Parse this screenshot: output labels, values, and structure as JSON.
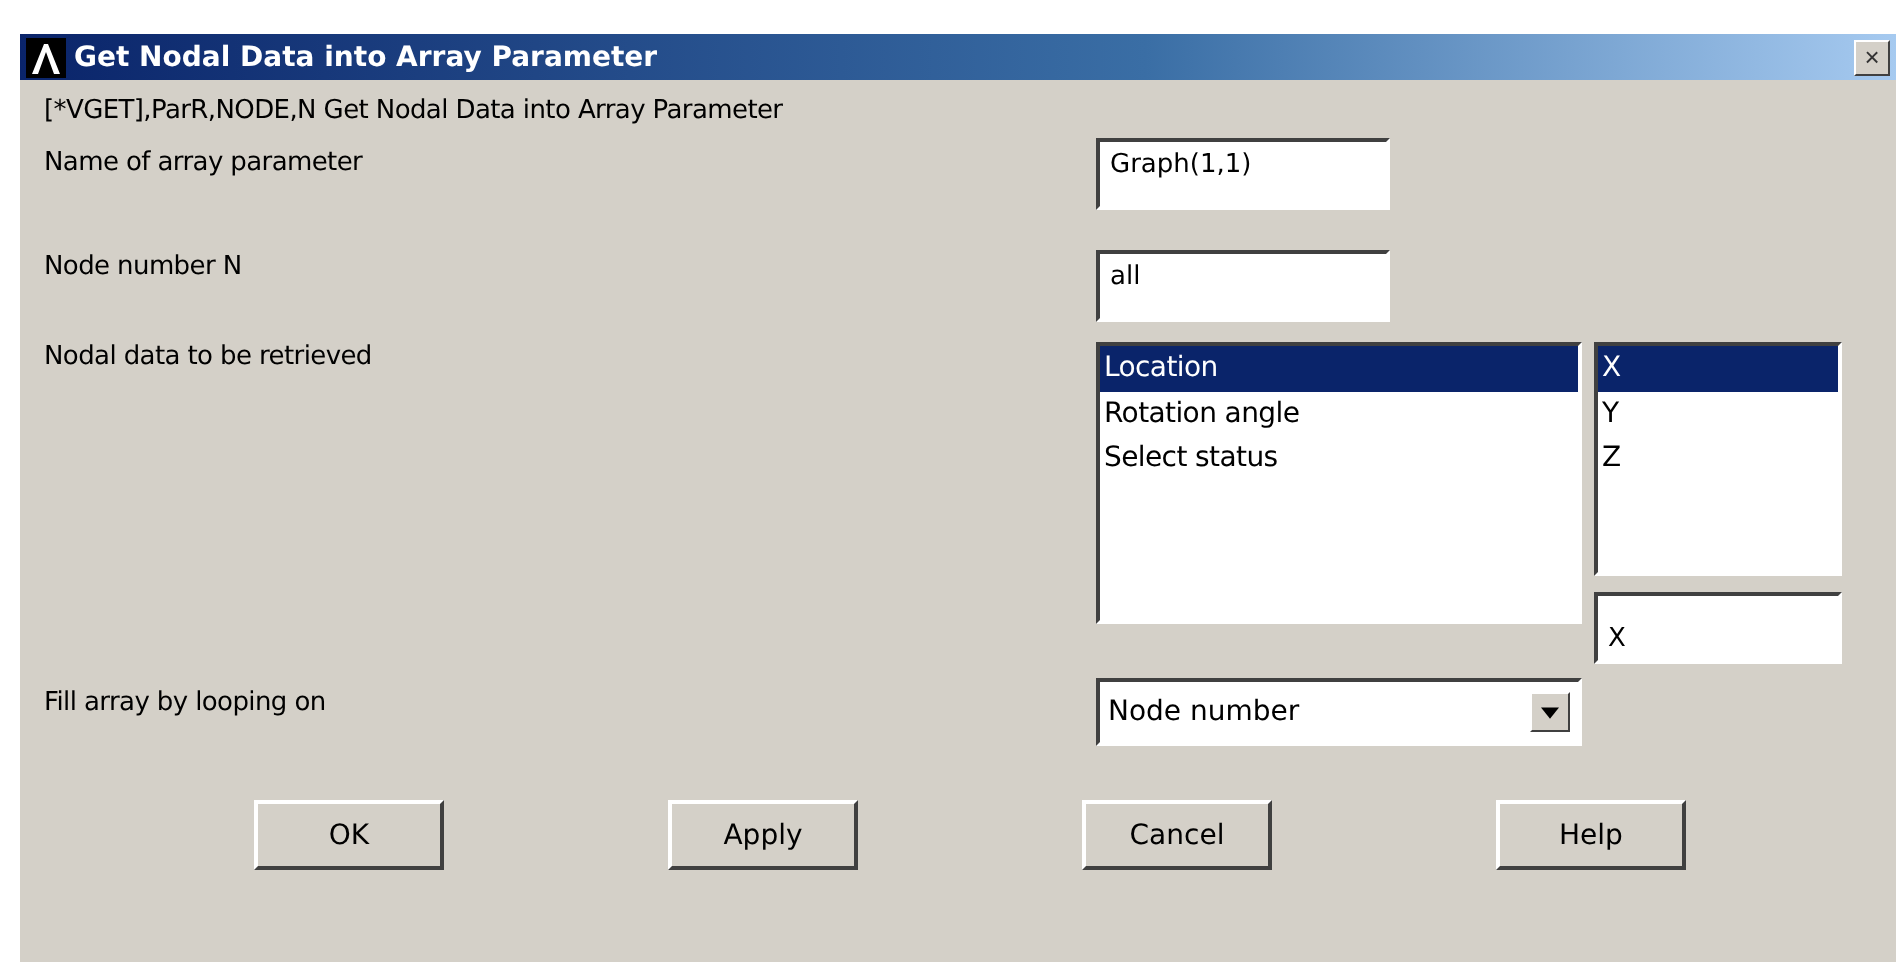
{
  "window": {
    "title": "Get Nodal Data into Array Parameter",
    "close": "×"
  },
  "command": "[*VGET],ParR,NODE,N  Get Nodal Data into Array Parameter",
  "array_name": {
    "label": "Name of array parameter",
    "value": "Graph(1,1)"
  },
  "node_number": {
    "label": "Node number N",
    "value": "all"
  },
  "nodal_data": {
    "label": "Nodal data to be retrieved",
    "items": [
      {
        "text": "Location",
        "selected": true
      },
      {
        "text": "Rotation angle",
        "selected": false
      },
      {
        "text": "Select status",
        "selected": false
      }
    ],
    "components": [
      {
        "text": "X",
        "selected": true
      },
      {
        "text": "Y",
        "selected": false
      },
      {
        "text": "Z",
        "selected": false
      }
    ],
    "component_value": "X"
  },
  "fill_by": {
    "label": "Fill array by looping on",
    "value": "Node number"
  },
  "buttons": [
    "OK",
    "Apply",
    "Cancel",
    "Help"
  ]
}
